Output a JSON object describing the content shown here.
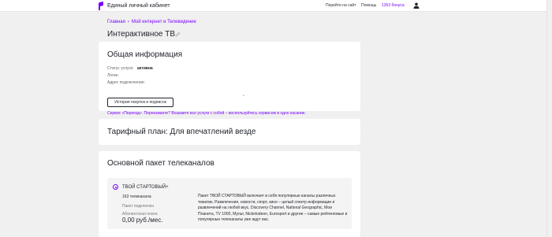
{
  "header": {
    "title": "Единый личный кабинет",
    "nav": [
      "Перейти на сайт",
      "Помощь"
    ],
    "bonus": "1353 бонуса",
    "accent": "#7700ff"
  },
  "breadcrumb": {
    "items": [
      "Главная",
      "Мой интернет и Телевидение"
    ]
  },
  "page_title": "Интерактивное ТВ",
  "general": {
    "heading": "Общая информация",
    "status_label": "Статус услуги:",
    "status_value": "активна",
    "login_label": "Логин:",
    "address_label": "Адрес подключения:",
    "address_marker": "•",
    "history_button": "История покупок и подписок",
    "link_text": "Сервис «Переезд». Переезжаете? Возьмите все услуги с собой – воспользуйтесь сервисом в одно касание."
  },
  "tariff": {
    "heading": "Тарифный план: Для впечатлений везде"
  },
  "package": {
    "heading": "Основной пакет телеканалов",
    "name": "ТВОЙ СТАРТОВЫЙ+",
    "count": "163 телеканала",
    "status": "Пакет подключен",
    "fee_label": "Абонентская плата",
    "fee": "0,00 руб./мес.",
    "description": "Пакет ТВОЙ СТАРТОВЫЙ включает в себя популярные каналы различных тематик. Развлечения, новости, спорт, кино – целый спектр информации и развлечений на любой вкус. Discovery Channel, National Geographic, Мои Планета, TV 1000, Мульт, Nickelodeon, Eurosport и другие – самые рейтинговые и популярные телеканалы уже ждут вас."
  }
}
